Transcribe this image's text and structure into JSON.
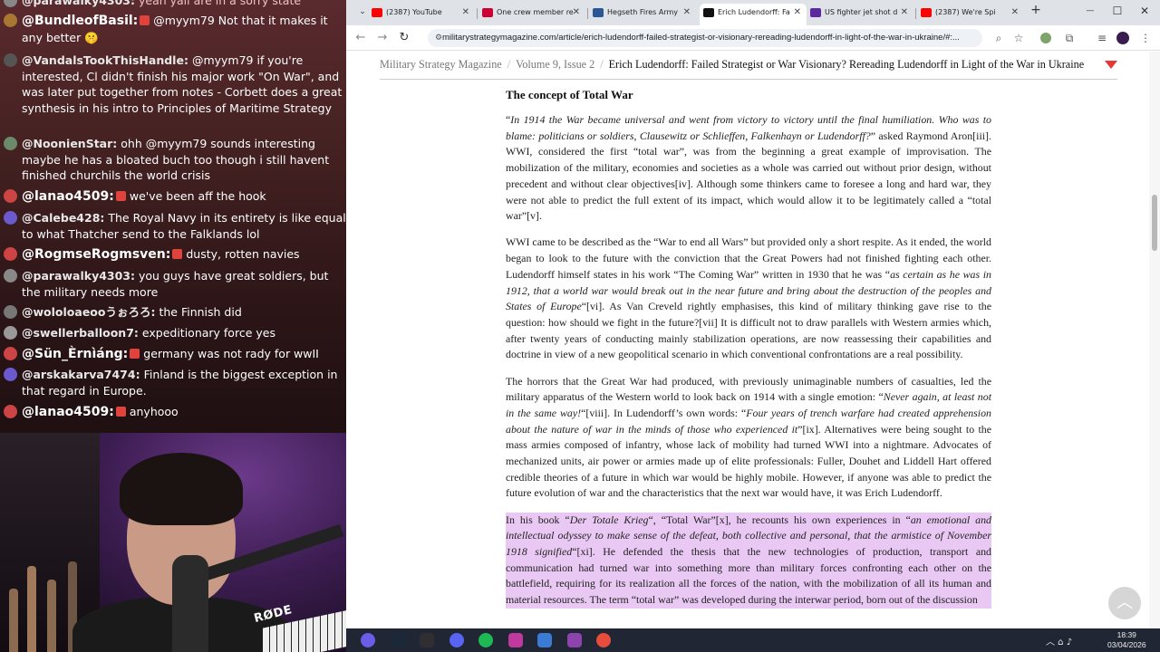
{
  "chat": {
    "messages": [
      {
        "user": "@parawalky4303",
        "text": "yeah yall are in a sorry state",
        "color": "#f2c2c2",
        "avatar": "#888"
      },
      {
        "user": "@BundleofBasil",
        "badge": true,
        "text": "@myym79 Not that it makes it any better 🤫",
        "color": "#fff",
        "avatar": "#aa7733",
        "big": true
      },
      {
        "user": "@VandalsTookThisHandle",
        "text": "@myym79 if you're interested, Cl didn't finish his major work \"On War\", and was later put together from notes - Corbett does a great synthesis in his intro to Principles of Maritime Strategy",
        "color": "#fff",
        "avatar": "#555"
      },
      {
        "user": "@NoonienStar",
        "text": "ohh @myym79 sounds interesting maybe he has a bloated buch too though i still havent finished churchils the world crisis",
        "color": "#fff",
        "avatar": "#6a8a6a"
      },
      {
        "user": "@lanao4509",
        "badge": true,
        "text": "we've been aff the hook",
        "color": "#fff",
        "avatar": "#c44",
        "big": true
      },
      {
        "user": "@Calebe428",
        "text": "The Royal Navy in its entirety is like equal to what Thatcher send to the Falklands lol",
        "color": "#fff",
        "avatar": "#6a5acd"
      },
      {
        "user": "@RogmseRogmsven",
        "badge": true,
        "text": "dusty, rotten navies",
        "color": "#fff",
        "avatar": "#c44",
        "big": true
      },
      {
        "user": "@parawalky4303",
        "text": "you guys have great soldiers, but the military needs more",
        "color": "#fff",
        "avatar": "#888"
      },
      {
        "user": "@wololoaeooうぉろろ",
        "text": "the Finnish did",
        "color": "#fff",
        "avatar": "#777"
      },
      {
        "user": "@swellerballoon7",
        "text": "expeditionary force yes",
        "color": "#fff",
        "avatar": "#999"
      },
      {
        "user": "@Sün_Èrnìáng",
        "badge": true,
        "text": "germany was not rady for wwII",
        "color": "#fff",
        "avatar": "#c44",
        "big": true
      },
      {
        "user": "@arskakarva7474",
        "text": "Finland is the biggest exception in that regard in Europe.",
        "color": "#fff",
        "avatar": "#6a5acd"
      },
      {
        "user": "@lanao4509",
        "badge": true,
        "text": "anyhooo",
        "color": "#fff",
        "avatar": "#c44",
        "big": true
      }
    ]
  },
  "webcam": {
    "mic_brand": "RØDE"
  },
  "browser": {
    "tabs": [
      {
        "label": "(2387) YouTube",
        "icon_color": "#ff0000",
        "active": false
      },
      {
        "label": "One crew member re",
        "icon_color": "#cc0033",
        "active": false
      },
      {
        "label": "Hegseth Fires Army",
        "icon_color": "#2b5797",
        "active": false
      },
      {
        "label": "Erich Ludendorff: Fa",
        "icon_color": "#111111",
        "active": true
      },
      {
        "label": "US fighter jet shot d",
        "icon_color": "#5b2aa0",
        "active": false
      },
      {
        "label": "(2387) We're Spi",
        "icon_color": "#ff0000",
        "active": false
      }
    ],
    "new_tab": "+",
    "window_controls": {
      "minimize": "—",
      "maximize": "☐",
      "close": "✕"
    },
    "url": "militarystrategymagazine.com/article/erich-ludendorff-failed-strategist-or-visionary-rereading-ludendorff-in-light-of-the-war-in-ukraine/#:..."
  },
  "page": {
    "breadcrumb": {
      "site": "Military Strategy Magazine",
      "issue": "Volume 9, Issue 2",
      "current": "Erich Ludendorff: Failed Strategist or War Visionary? Rereading Ludendorff in Light of the War in Ukraine",
      "separator": "/"
    },
    "heading": "The concept of Total War",
    "p1": {
      "q_open": "“",
      "quote": "In 1914 the War became universal and went from victory to victory until the final humiliation. Who was to blame: politicians or soldiers, Clausewitz or Schlieffen, Falkenhayn or Ludendorff?",
      "rest": "” asked Raymond Aron[iii]. WWI, considered the first “total war”, was from the beginning a great example of improvisation. The mobilization of the military, economies and societies as a whole was carried out without prior design, without precedent and without clear objectives[iv]. Although some thinkers came to foresee a long and hard war, they were not able to predict the full extent of its impact, which would allow it to be legitimately called a “total war”[v]."
    },
    "p2": {
      "pre": "WWI came to be described as the “War to end all Wars” but provided only a short respite. As it ended, the world began to look to the future with the conviction that the Great Powers had not finished fighting each other. Ludendorff himself states in his work “The Coming War” written in 1930 that he was “",
      "quote": "as certain as he was in 1912, that a world war would break out in the near future and bring about the destruction of the peoples and States of Europe",
      "post": "“[vi]. As Van Creveld rightly emphasises, this kind of military thinking gave rise to the question: how should we fight in the future?[vii] It is difficult not to draw parallels with Western armies which, after twenty years of conducting mainly stabilization operations, are now reassessing their capabilities and doctrine in view of a new geopolitical scenario in which conventional confrontations are a real possibility."
    },
    "p3": {
      "pre": "The horrors that the Great War had produced, with previously unimaginable numbers of casualties, led the military apparatus of the Western world to look back on 1914 with a single emotion: “",
      "quote1": "Never again, at least not in the same way!",
      "mid": "“[viii]. In Ludendorff’s own words: “",
      "quote2": "Four years of trench warfare had created apprehension about the nature of war in the minds of those who experienced it",
      "post": "”[ix]. Alternatives were being sought to the mass armies composed of infantry, whose lack of mobility had turned WWI into a nightmare. Advocates of mechanized units, air power or armies made up of elite professionals: Fuller, Douhet and Liddell Hart offered credible theories of a future in which war would be highly mobile. However, if anyone was able to predict the future evolution of war and the characteristics that the next war would have, it was Erich Ludendorff."
    },
    "p4": {
      "pre": "In his book “",
      "title": "Der Totale Krieg",
      "mid": "“, “Total War”[x], he recounts his own experiences in “",
      "quote": "an emotional and intellectual odyssey to make sense of the defeat, both collective and personal, that the armistice of November 1918 signified",
      "post": "“[xi]. He defended the thesis that the new technologies of production, transport and communication had turned war into something more than military forces confronting each other on the battlefield, requiring for its realization all the forces of the nation, with the mobilization of all its human and material resources. The term “total war” was developed during the interwar period, born out of the discussion"
    },
    "highlight_color": "#e9c8f4",
    "scroll_top_icon": "︿"
  },
  "taskbar": {
    "apps": [
      "windows-logo",
      "steam",
      "obs",
      "discord",
      "spotify",
      "app",
      "app",
      "app",
      "chrome"
    ],
    "time": "18:39",
    "date": "03/04/2026",
    "tray_icons": "︿ ⌂ ♪"
  }
}
